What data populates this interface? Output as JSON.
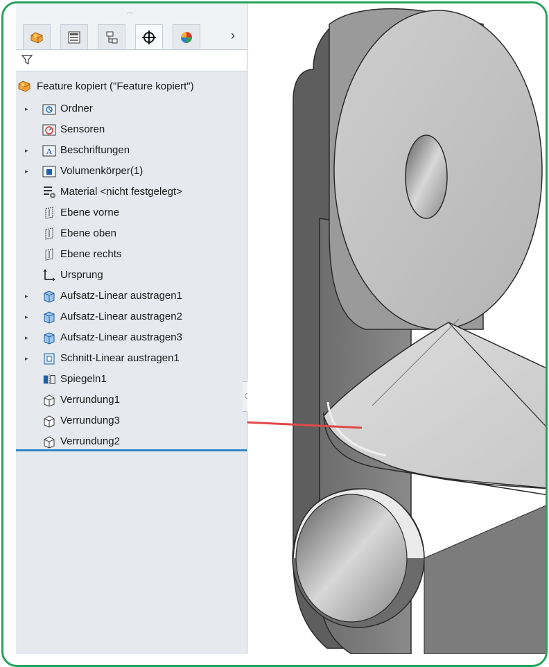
{
  "feature_tree": {
    "root_label": "Feature kopiert (\"Feature kopiert\")",
    "tabs": [
      "feature-manager-tab",
      "property-manager-tab",
      "configuration-manager-tab",
      "dimxpert-manager-tab",
      "display-manager-tab"
    ],
    "items": [
      {
        "label": "Ordner",
        "icon": "folder-icon",
        "expandable": true
      },
      {
        "label": "Sensoren",
        "icon": "sensor-icon",
        "expandable": false
      },
      {
        "label": "Beschriftungen",
        "icon": "annotation-icon",
        "expandable": true
      },
      {
        "label": "Volumenkörper(1)",
        "icon": "solid-bodies-icon",
        "expandable": true
      },
      {
        "label": "Material <nicht festgelegt>",
        "icon": "material-icon",
        "expandable": false
      },
      {
        "label": "Ebene vorne",
        "icon": "plane-icon",
        "expandable": false
      },
      {
        "label": "Ebene oben",
        "icon": "plane-icon",
        "expandable": false
      },
      {
        "label": "Ebene rechts",
        "icon": "plane-icon",
        "expandable": false
      },
      {
        "label": "Ursprung",
        "icon": "origin-icon",
        "expandable": false
      },
      {
        "label": "Aufsatz-Linear austragen1",
        "icon": "extrude-icon",
        "expandable": true
      },
      {
        "label": "Aufsatz-Linear austragen2",
        "icon": "extrude-icon",
        "expandable": true
      },
      {
        "label": "Aufsatz-Linear austragen3",
        "icon": "extrude-icon",
        "expandable": true
      },
      {
        "label": "Schnitt-Linear austragen1",
        "icon": "cut-extrude-icon",
        "expandable": true
      },
      {
        "label": "Spiegeln1",
        "icon": "mirror-icon",
        "expandable": false
      },
      {
        "label": "Verrundung1",
        "icon": "fillet-icon",
        "expandable": false
      },
      {
        "label": "Verrundung3",
        "icon": "fillet-icon",
        "expandable": false
      },
      {
        "label": "Verrundung2",
        "icon": "fillet-icon",
        "expandable": false
      }
    ]
  },
  "colors": {
    "frame": "#24a35a",
    "rollback_bar": "#2f86c9",
    "arrow": "#e04848"
  }
}
